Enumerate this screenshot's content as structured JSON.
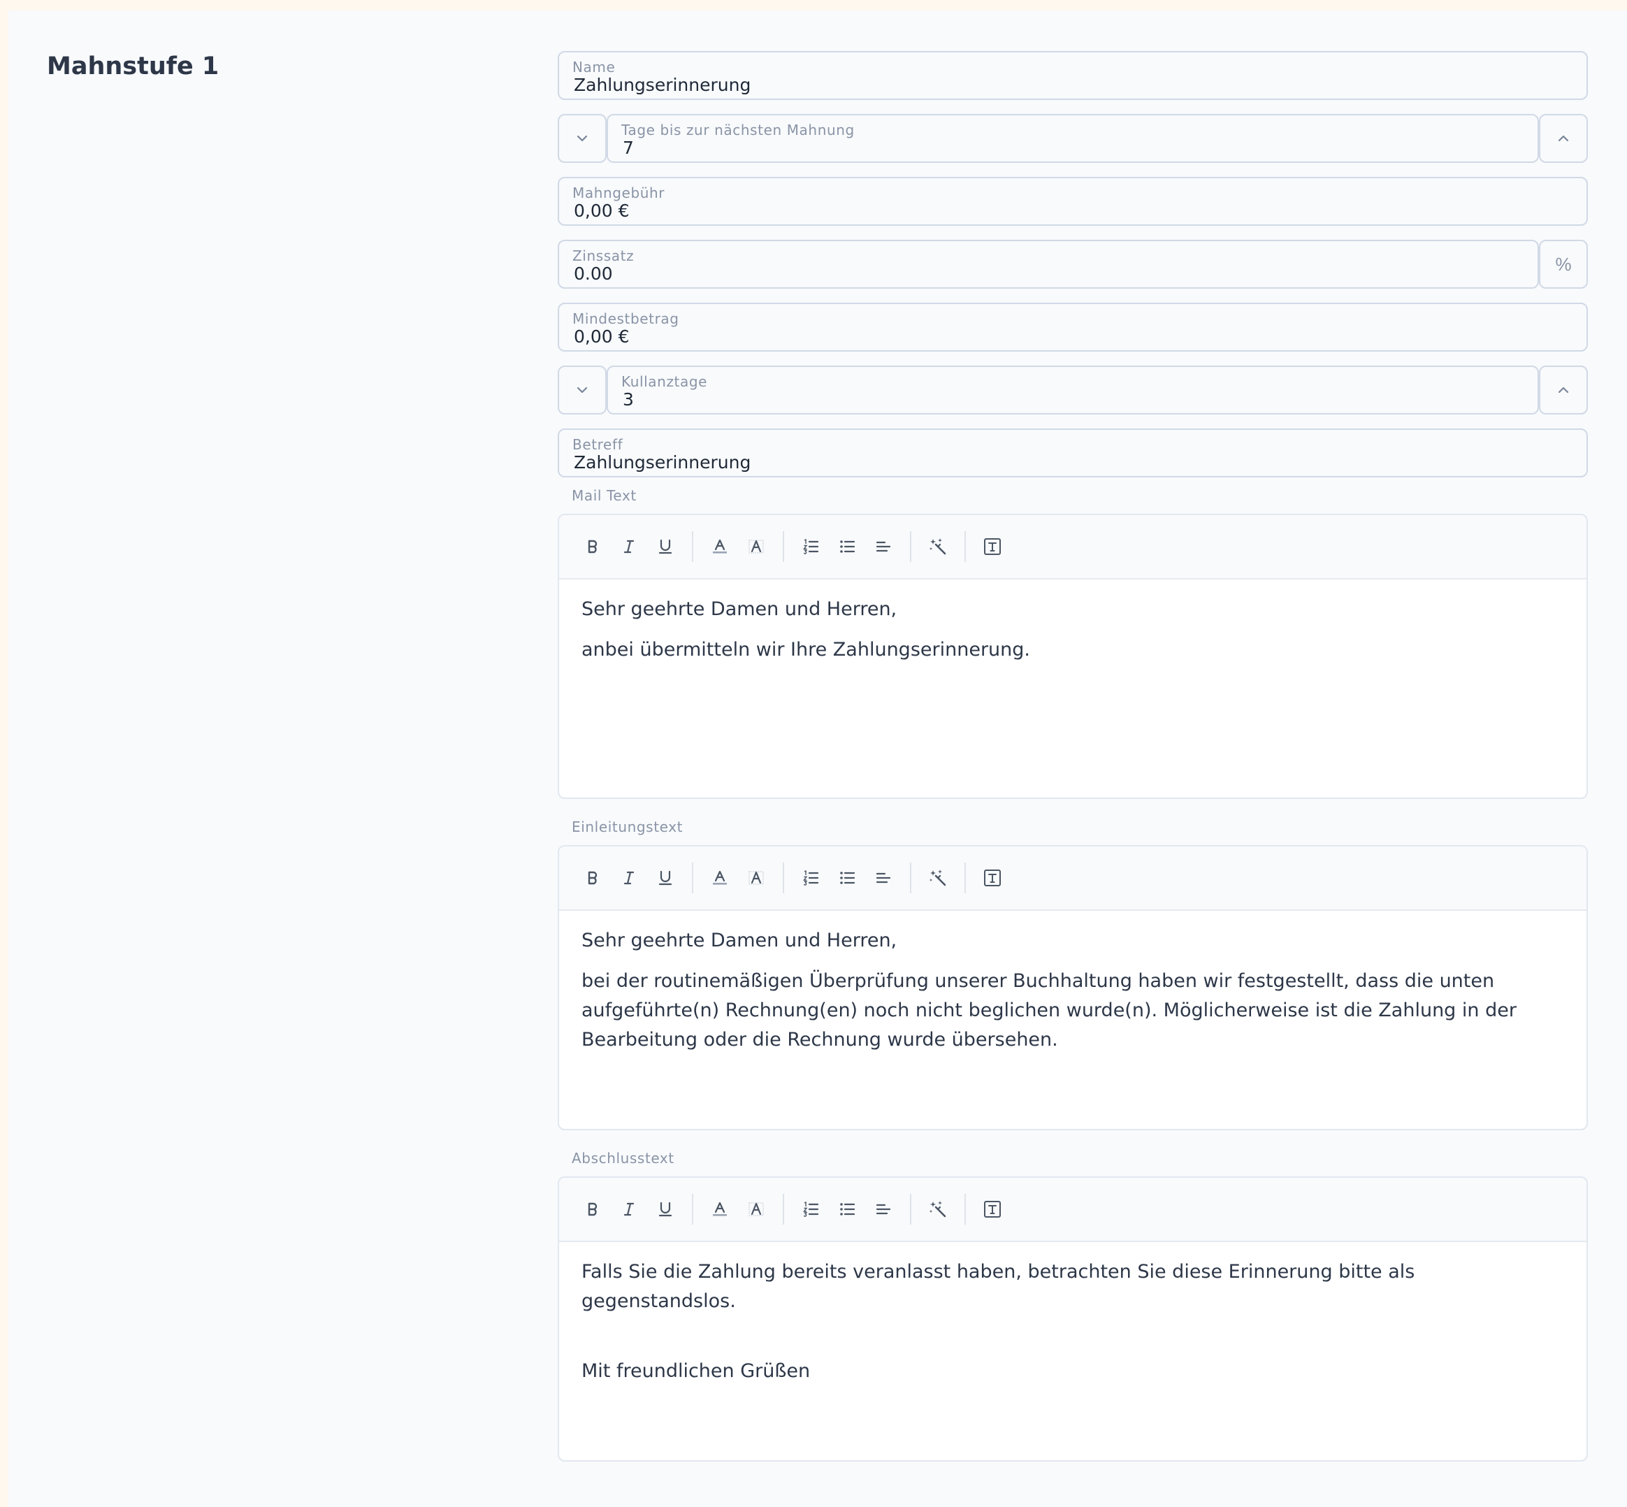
{
  "section": {
    "title": "Mahnstufe 1"
  },
  "fields": {
    "name": {
      "label": "Name",
      "value": "Zahlungserinnerung"
    },
    "days": {
      "label": "Tage bis zur nächsten Mahnung",
      "value": "7"
    },
    "fee": {
      "label": "Mahngebühr",
      "value": "0,00 €"
    },
    "rate": {
      "label": "Zinssatz",
      "value": "0.00",
      "suffix": "%"
    },
    "min": {
      "label": "Mindestbetrag",
      "value": "0,00 €"
    },
    "grace": {
      "label": "Kullanztage",
      "value": "3"
    },
    "subject": {
      "label": "Betreff",
      "value": "Zahlungserinnerung"
    }
  },
  "editors": {
    "mail": {
      "label": "Mail Text",
      "paragraphs": [
        "Sehr geehrte Damen und Herren,",
        "anbei übermitteln wir Ihre Zahlungserinnerung."
      ]
    },
    "intro": {
      "label": "Einleitungstext",
      "paragraphs": [
        "Sehr geehrte Damen und Herren,",
        "bei der routinemäßigen Überprüfung unserer Buchhaltung haben wir festgestellt, dass die unten aufgeführte(n) Rechnung(en) noch nicht beglichen wurde(n). Möglicherweise ist die Zahlung in der Bearbeitung oder die Rechnung wurde übersehen."
      ]
    },
    "closing": {
      "label": "Abschlusstext",
      "paragraphs": [
        "Falls Sie die Zahlung bereits veranlasst haben, betrachten Sie diese Erinnerung bitte als gegenstandslos.",
        "Mit freundlichen Grüßen"
      ]
    }
  },
  "toolbar_icons": [
    "bold-icon",
    "italic-icon",
    "underline-icon",
    "text-color-icon",
    "highlight-icon",
    "ordered-list-icon",
    "bullet-list-icon",
    "align-left-icon",
    "magic-wand-icon",
    "clear-format-icon"
  ],
  "colors": {
    "border": "#d1d9e6",
    "label": "#8a94a6",
    "text": "#1f2937",
    "background": "#f8fafc"
  }
}
